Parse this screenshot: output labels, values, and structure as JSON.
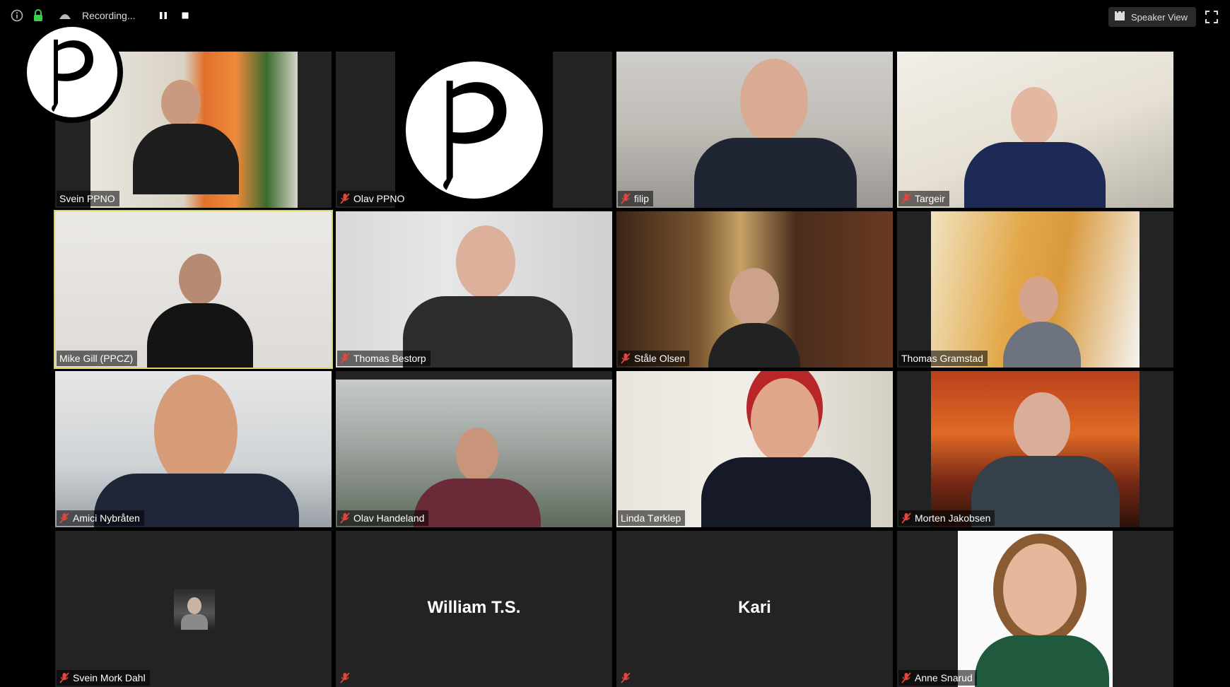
{
  "toolbar": {
    "recording_label": "Recording...",
    "speaker_view_label": "Speaker View"
  },
  "colors": {
    "active_speaker_border": "#d8d46a",
    "mute_icon": "#e0473c",
    "tile_background": "#232323"
  },
  "participants": [
    {
      "name": "Svein  PPNO",
      "muted": false
    },
    {
      "name": "Olav PPNO",
      "muted": true
    },
    {
      "name": "filip",
      "muted": true
    },
    {
      "name": "Targeir",
      "muted": true
    },
    {
      "name": "Mike Gill (PPCZ)",
      "muted": false,
      "active_speaker": true
    },
    {
      "name": "Thomas Bestorp",
      "muted": true
    },
    {
      "name": "Ståle Olsen",
      "muted": true
    },
    {
      "name": "Thomas Gramstad",
      "muted": false
    },
    {
      "name": "Amici Nybråten",
      "muted": true
    },
    {
      "name": "Olav Handeland",
      "muted": true
    },
    {
      "name": "Linda Tørklep",
      "muted": false
    },
    {
      "name": "Morten Jakobsen",
      "muted": true
    },
    {
      "name": "Svein Mork Dahl",
      "muted": true
    },
    {
      "name": "",
      "display_name": "William T.S.",
      "muted": true
    },
    {
      "name": "",
      "display_name": "Kari",
      "muted": true
    },
    {
      "name": "Anne Snarud",
      "muted": true
    }
  ],
  "icons": {
    "info": "info-icon",
    "security": "lock-icon",
    "recording": "recording-icon",
    "pause": "pause-icon",
    "stop": "stop-icon",
    "speaker_view": "grid-icon",
    "fullscreen": "fullscreen-icon",
    "muted": "microphone-muted-icon"
  }
}
